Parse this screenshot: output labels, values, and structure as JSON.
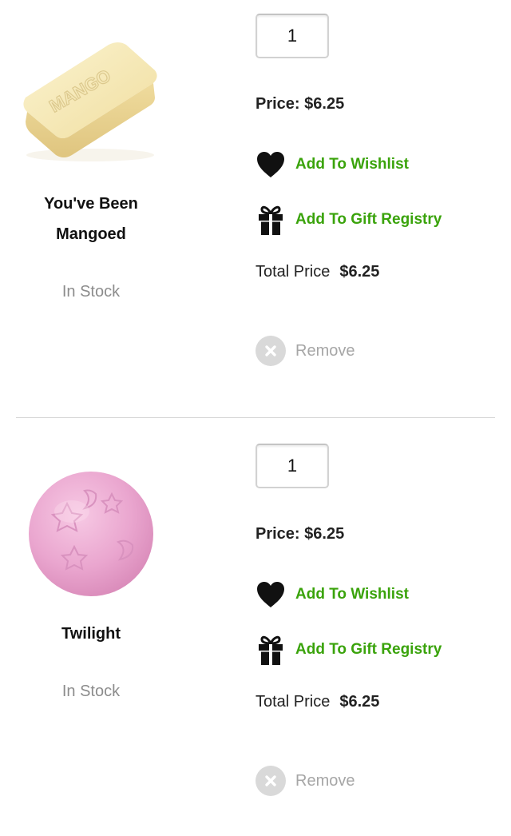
{
  "cart": {
    "items": [
      {
        "name_line1": "You've Been",
        "name_line2": "Mangoed",
        "image_icon": "mango-soap-bar-image",
        "image_embossed_text": "MANGO",
        "stock": "In Stock",
        "quantity": "1",
        "price_label": "Price:",
        "price_value": "$6.25",
        "wishlist_label": "Add To Wishlist",
        "gift_label": "Add To Gift Registry",
        "total_label": "Total Price",
        "total_value": "$6.25",
        "remove_label": "Remove",
        "remove_icon_glyph": "x"
      },
      {
        "name_line1": "Twilight",
        "image_icon": "pink-bath-bomb-image",
        "stock": "In Stock",
        "quantity": "1",
        "price_label": "Price:",
        "price_value": "$6.25",
        "wishlist_label": "Add To Wishlist",
        "gift_label": "Add To Gift Registry",
        "total_label": "Total Price",
        "total_value": "$6.25",
        "remove_label": "Remove",
        "remove_icon_glyph": "x"
      }
    ]
  },
  "colors": {
    "action_green": "#3aa30b",
    "muted_gray": "#8c8c8c",
    "remove_gray": "#a6a6a6",
    "soap_cream": "#f6e9b6",
    "bath_bomb_pink": "#eaa6cf"
  },
  "icons": {
    "wishlist": "heart-icon",
    "gift": "gift-icon",
    "remove": "remove-circle-icon"
  }
}
